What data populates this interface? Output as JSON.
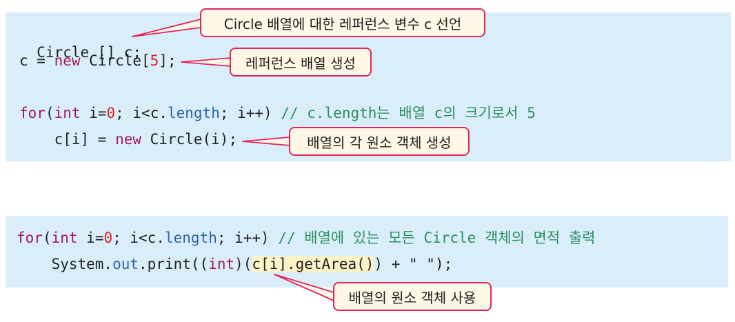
{
  "block1": {
    "line1": "Circle [] c;",
    "line2": {
      "pre": "c = ",
      "kw": "new",
      "mid": " Circle[",
      "num": "5",
      "post": "];"
    },
    "line3": {
      "kw1": "for",
      "p1": "(",
      "kw2": "int",
      "p2": " i=",
      "num": "0",
      "p3": "; i<c.",
      "fld": "length",
      "p4": "; i++) ",
      "comment": "// c.length는 배열 c의 크기로서 5"
    },
    "line4": {
      "indent": "    c[i] = ",
      "kw": "new",
      "post": " Circle(i);"
    }
  },
  "block2": {
    "line1": {
      "kw1": "for",
      "p1": "(",
      "kw2": "int",
      "p2": " i=",
      "num": "0",
      "p3": "; i<c.",
      "fld": "length",
      "p4": "; i++) ",
      "comment": "// 배열에 있는 모든 Circle 객체의 면적 출력"
    },
    "line2": {
      "pre": "    System.",
      "fld": "out",
      "mid": ".print((",
      "kw": "int",
      "p": ")(",
      "hl": "c[i].getArea()",
      "post": ") + ",
      "str": "\" \"",
      "end": ");"
    }
  },
  "callouts": {
    "declare": "Circle 배열에 대한 레퍼런스 변수 c 선언",
    "create_ref": "레퍼런스 배열 생성",
    "create_obj": "배열의 각 원소 객체 생성",
    "use_obj": "배열의 원소 객체 사용"
  },
  "colors": {
    "panel": "#daeefa",
    "keyword": "#a0195d",
    "number": "#d5221e",
    "field": "#2a62a8",
    "comment": "#2b8f5e",
    "callout_border": "#e0245f",
    "callout_fill": "#fff8e6"
  }
}
